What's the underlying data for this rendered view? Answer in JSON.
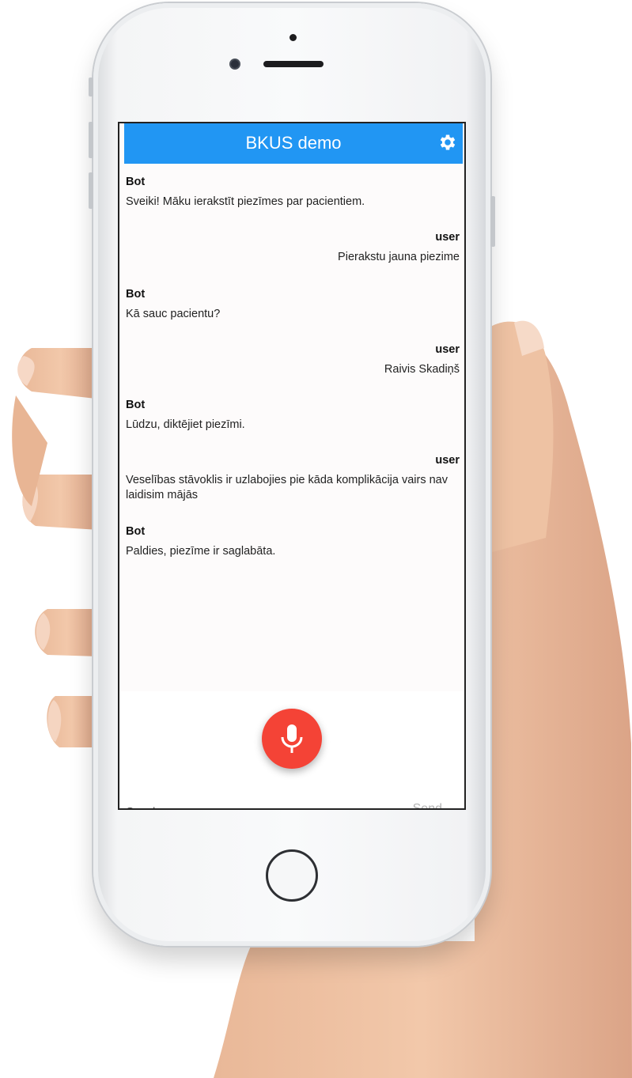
{
  "app": {
    "title": "BKUS demo"
  },
  "header": {
    "settings_icon": "gear-icon"
  },
  "messages": [
    {
      "sender": "Bot",
      "text": "Sveiki! Māku ierakstīt piezīmes par pacientiem.",
      "side": "left"
    },
    {
      "sender": "user",
      "text": "Pierakstu jauna piezime",
      "side": "right"
    },
    {
      "sender": "Bot",
      "text": "Kā sauc pacientu?",
      "side": "left"
    },
    {
      "sender": "user",
      "text": "Raivis Skadiņš",
      "side": "right"
    },
    {
      "sender": "Bot",
      "text": "Lūdzu, diktējiet piezīmi.",
      "side": "left"
    },
    {
      "sender": "user",
      "text": "Veselības stāvoklis ir uzlabojies pie kāda komplikācija vairs nav laidisim mājās",
      "side": "right"
    },
    {
      "sender": "Bot",
      "text": "Paldies, piezīme ir saglabāta.",
      "side": "left"
    }
  ],
  "input": {
    "placeholder": "Send a message",
    "value": ""
  },
  "send": {
    "label": "Send"
  },
  "mic": {
    "icon": "microphone-icon",
    "color": "#f44336"
  },
  "colors": {
    "header": "#2196f3",
    "mic_button": "#f44336",
    "background": "#fdfbfb"
  }
}
